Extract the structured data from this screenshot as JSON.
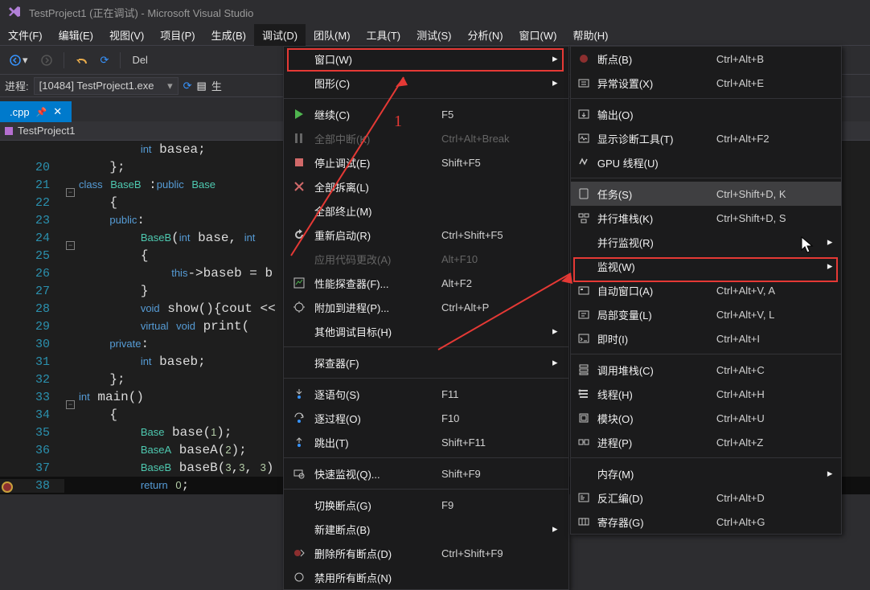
{
  "title": "TestProject1 (正在调试) - Microsoft Visual Studio",
  "menubar": [
    "文件(F)",
    "编辑(E)",
    "视图(V)",
    "项目(P)",
    "生成(B)",
    "调试(D)",
    "团队(M)",
    "工具(T)",
    "测试(S)",
    "分析(N)",
    "窗口(W)",
    "帮助(H)"
  ],
  "active_menu_index": 5,
  "toolbar": {
    "del_label": "Del"
  },
  "process": {
    "label": "进程:",
    "value": "[10484] TestProject1.exe",
    "lifecycle_btn": "生"
  },
  "tab": {
    "name": ".cpp"
  },
  "breadcrumb": {
    "item": "TestProject1"
  },
  "code_lines": [
    {
      "n": "",
      "t": "        int basea;",
      "fold": ""
    },
    {
      "n": "20",
      "t": "    };",
      "fold": ""
    },
    {
      "n": "21",
      "t": "class BaseB :public Base",
      "fold": "-",
      "cls": true
    },
    {
      "n": "22",
      "t": "    {",
      "fold": ""
    },
    {
      "n": "23",
      "t": "    public:",
      "fold": ""
    },
    {
      "n": "24",
      "t": "        BaseB(int base, int",
      "fold": "-",
      "ctor": true
    },
    {
      "n": "25",
      "t": "        {",
      "fold": ""
    },
    {
      "n": "26",
      "t": "            this->baseb = b",
      "fold": ""
    },
    {
      "n": "27",
      "t": "        }",
      "fold": ""
    },
    {
      "n": "28",
      "t": "        void show(){cout <<",
      "fold": ""
    },
    {
      "n": "29",
      "t": "        virtual void print(",
      "fold": ""
    },
    {
      "n": "30",
      "t": "    private:",
      "fold": ""
    },
    {
      "n": "31",
      "t": "        int baseb;",
      "fold": ""
    },
    {
      "n": "32",
      "t": "    };",
      "fold": ""
    },
    {
      "n": "33",
      "t": "int main()",
      "fold": "-",
      "main": true
    },
    {
      "n": "34",
      "t": "    {",
      "fold": ""
    },
    {
      "n": "35",
      "t": "        Base base(1);",
      "fold": ""
    },
    {
      "n": "36",
      "t": "        BaseA baseA(2);",
      "fold": ""
    },
    {
      "n": "37",
      "t": "        BaseB baseB(3,3, 3)",
      "fold": ""
    },
    {
      "n": "38",
      "t": "        return 0;",
      "fold": "",
      "current": true,
      "bp": true
    }
  ],
  "menu1": [
    {
      "icon": "",
      "label": "窗口(W)",
      "shortcut": "",
      "sub": true,
      "boxed": true
    },
    {
      "icon": "",
      "label": "图形(C)",
      "shortcut": "",
      "sub": true
    },
    {
      "sep": true
    },
    {
      "icon": "play",
      "label": "继续(C)",
      "shortcut": "F5",
      "green": true
    },
    {
      "icon": "pause",
      "label": "全部中断(K)",
      "shortcut": "Ctrl+Alt+Break",
      "disabled": true
    },
    {
      "icon": "stop",
      "label": "停止调试(E)",
      "shortcut": "Shift+F5",
      "red": true
    },
    {
      "icon": "detach",
      "label": "全部拆离(L)",
      "shortcut": "",
      "red": true
    },
    {
      "icon": "",
      "label": "全部终止(M)",
      "shortcut": ""
    },
    {
      "icon": "restart",
      "label": "重新启动(R)",
      "shortcut": "Ctrl+Shift+F5"
    },
    {
      "icon": "",
      "label": "应用代码更改(A)",
      "shortcut": "Alt+F10",
      "disabled": true
    },
    {
      "icon": "perf",
      "label": "性能探查器(F)...",
      "shortcut": "Alt+F2"
    },
    {
      "icon": "attach",
      "label": "附加到进程(P)...",
      "shortcut": "Ctrl+Alt+P"
    },
    {
      "icon": "",
      "label": "其他调试目标(H)",
      "shortcut": "",
      "sub": true
    },
    {
      "sep": true
    },
    {
      "icon": "",
      "label": "探查器(F)",
      "shortcut": "",
      "sub": true
    },
    {
      "sep": true
    },
    {
      "icon": "stepinto",
      "label": "逐语句(S)",
      "shortcut": "F11"
    },
    {
      "icon": "stepover",
      "label": "逐过程(O)",
      "shortcut": "F10"
    },
    {
      "icon": "stepout",
      "label": "跳出(T)",
      "shortcut": "Shift+F11"
    },
    {
      "sep": true
    },
    {
      "icon": "quickwatch",
      "label": "快速监视(Q)...",
      "shortcut": "Shift+F9"
    },
    {
      "sep": true
    },
    {
      "icon": "",
      "label": "切换断点(G)",
      "shortcut": "F9"
    },
    {
      "icon": "",
      "label": "新建断点(B)",
      "shortcut": "",
      "sub": true
    },
    {
      "icon": "delbp",
      "label": "删除所有断点(D)",
      "shortcut": "Ctrl+Shift+F9"
    },
    {
      "icon": "disbp",
      "label": "禁用所有断点(N)",
      "shortcut": ""
    }
  ],
  "menu2": [
    {
      "icon": "bp",
      "label": "断点(B)",
      "shortcut": "Ctrl+Alt+B"
    },
    {
      "icon": "excset",
      "label": "异常设置(X)",
      "shortcut": "Ctrl+Alt+E"
    },
    {
      "sep": true
    },
    {
      "icon": "output",
      "label": "输出(O)",
      "shortcut": ""
    },
    {
      "icon": "diag",
      "label": "显示诊断工具(T)",
      "shortcut": "Ctrl+Alt+F2"
    },
    {
      "icon": "gpu",
      "label": "GPU 线程(U)",
      "shortcut": ""
    },
    {
      "sep": true
    },
    {
      "icon": "task",
      "label": "任务(S)",
      "shortcut": "Ctrl+Shift+D, K",
      "hl": true
    },
    {
      "icon": "pstack",
      "label": "并行堆栈(K)",
      "shortcut": "Ctrl+Shift+D, S"
    },
    {
      "icon": "",
      "label": "并行监视(R)",
      "shortcut": "",
      "sub": true
    },
    {
      "icon": "",
      "label": "监视(W)",
      "shortcut": "",
      "sub": true
    },
    {
      "icon": "autos",
      "label": "自动窗口(A)",
      "shortcut": "Ctrl+Alt+V, A",
      "boxed": true
    },
    {
      "icon": "locals",
      "label": "局部变量(L)",
      "shortcut": "Ctrl+Alt+V, L"
    },
    {
      "icon": "imm",
      "label": "即时(I)",
      "shortcut": "Ctrl+Alt+I"
    },
    {
      "sep": true
    },
    {
      "icon": "callstack",
      "label": "调用堆栈(C)",
      "shortcut": "Ctrl+Alt+C"
    },
    {
      "icon": "threads",
      "label": "线程(H)",
      "shortcut": "Ctrl+Alt+H"
    },
    {
      "icon": "modules",
      "label": "模块(O)",
      "shortcut": "Ctrl+Alt+U"
    },
    {
      "icon": "proc",
      "label": "进程(P)",
      "shortcut": "Ctrl+Alt+Z"
    },
    {
      "sep": true
    },
    {
      "icon": "",
      "label": "内存(M)",
      "shortcut": "",
      "sub": true
    },
    {
      "icon": "disasm",
      "label": "反汇编(D)",
      "shortcut": "Ctrl+Alt+D"
    },
    {
      "icon": "reg",
      "label": "寄存器(G)",
      "shortcut": "Ctrl+Alt+G"
    }
  ],
  "annotations": {
    "label1": "1"
  }
}
